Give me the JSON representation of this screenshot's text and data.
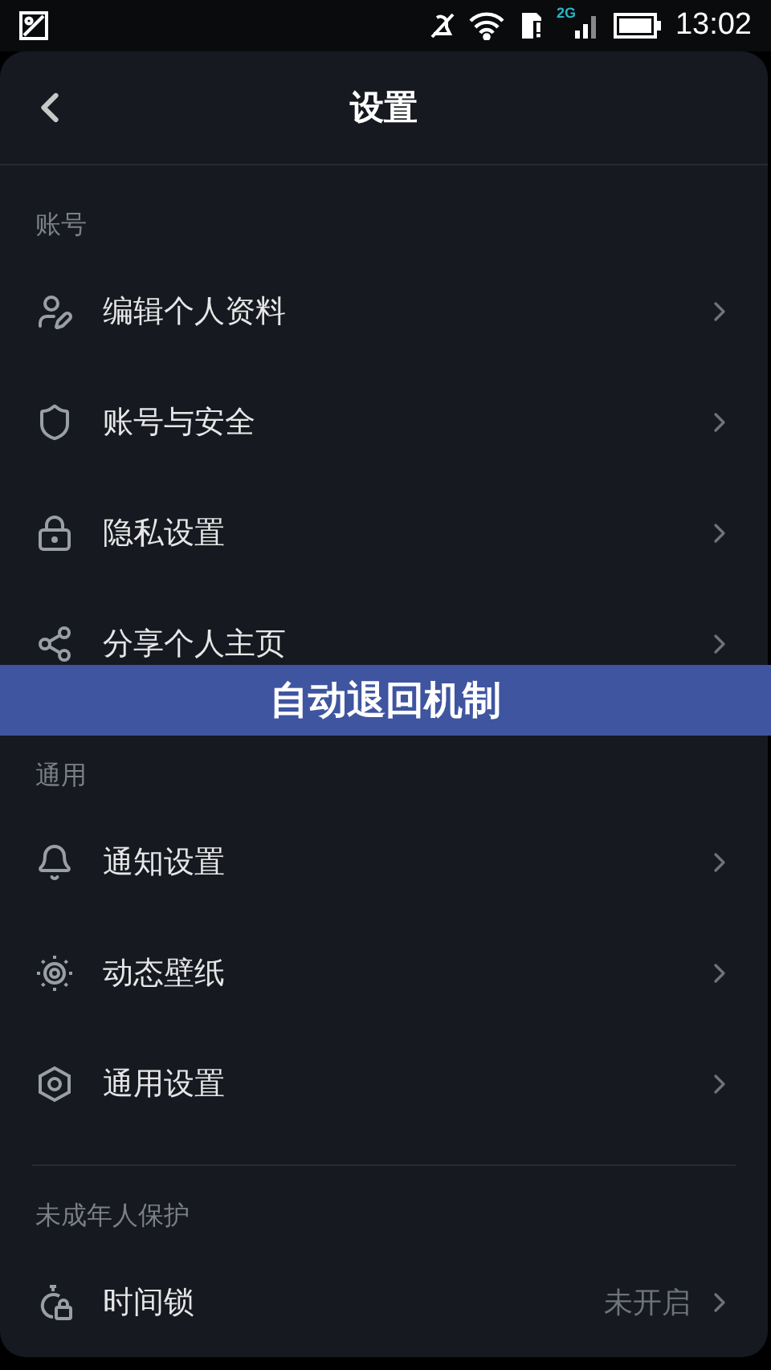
{
  "status_bar": {
    "network": "2G",
    "time": "13:02"
  },
  "header": {
    "title": "设置"
  },
  "sections": [
    {
      "title": "账号",
      "items": [
        {
          "label": "编辑个人资料"
        },
        {
          "label": "账号与安全"
        },
        {
          "label": "隐私设置"
        },
        {
          "label": "分享个人主页"
        }
      ]
    },
    {
      "title": "通用",
      "items": [
        {
          "label": "通知设置"
        },
        {
          "label": "动态壁纸"
        },
        {
          "label": "通用设置"
        }
      ]
    },
    {
      "title": "未成年人保护",
      "items": [
        {
          "label": "时间锁",
          "value": "未开启"
        }
      ]
    }
  ],
  "banner": {
    "text": "自动退回机制"
  }
}
